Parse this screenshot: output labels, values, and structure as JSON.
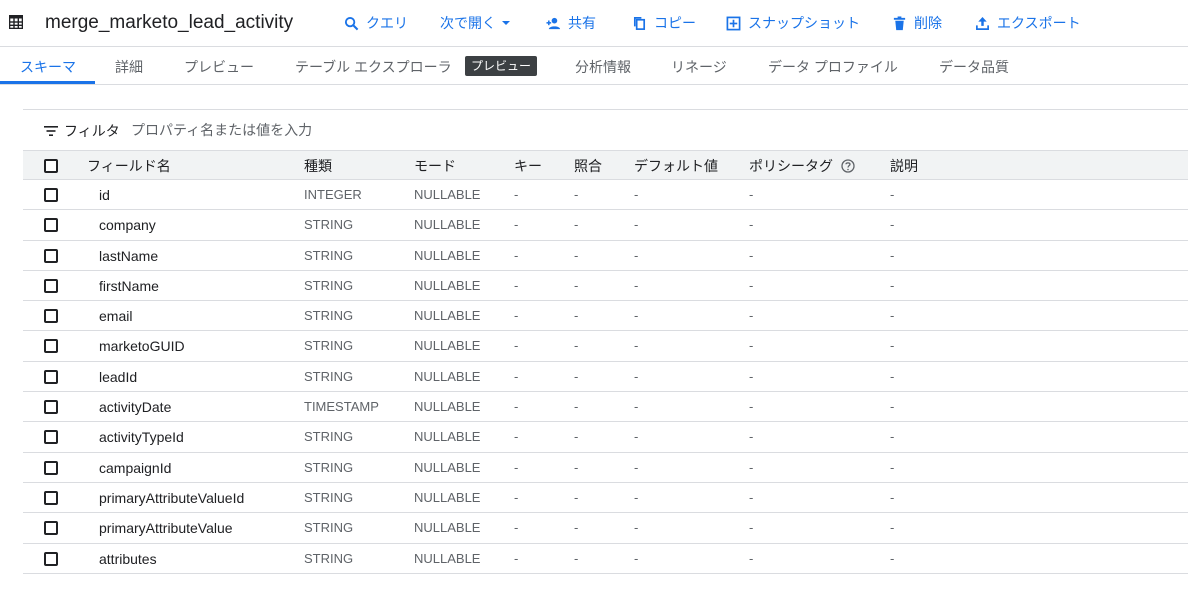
{
  "header": {
    "title": "merge_marketo_lead_activity",
    "actions": {
      "query": "クエリ",
      "open_with": "次で開く",
      "share": "共有",
      "copy": "コピー",
      "snapshot": "スナップショット",
      "delete": "削除",
      "export": "エクスポート"
    }
  },
  "tabs": {
    "schema": "スキーマ",
    "details": "詳細",
    "preview": "プレビュー",
    "table_explorer": "テーブル エクスプローラ",
    "table_explorer_badge": "プレビュー",
    "insights": "分析情報",
    "lineage": "リネージ",
    "data_profile": "データ プロファイル",
    "data_quality": "データ品質",
    "active": "schema"
  },
  "filter": {
    "label": "フィルタ",
    "placeholder": "プロパティ名または値を入力",
    "value": ""
  },
  "schema": {
    "columns": {
      "field_name": "フィールド名",
      "type": "種類",
      "mode": "モード",
      "key": "キー",
      "collation": "照合",
      "default_value": "デフォルト値",
      "policy_tags": "ポリシータグ",
      "description": "説明"
    },
    "rows": [
      {
        "name": "id",
        "type": "INTEGER",
        "mode": "NULLABLE",
        "key": "-",
        "collation": "-",
        "default": "-",
        "policy": "-",
        "description": "-"
      },
      {
        "name": "company",
        "type": "STRING",
        "mode": "NULLABLE",
        "key": "-",
        "collation": "-",
        "default": "-",
        "policy": "-",
        "description": "-"
      },
      {
        "name": "lastName",
        "type": "STRING",
        "mode": "NULLABLE",
        "key": "-",
        "collation": "-",
        "default": "-",
        "policy": "-",
        "description": "-"
      },
      {
        "name": "firstName",
        "type": "STRING",
        "mode": "NULLABLE",
        "key": "-",
        "collation": "-",
        "default": "-",
        "policy": "-",
        "description": "-"
      },
      {
        "name": "email",
        "type": "STRING",
        "mode": "NULLABLE",
        "key": "-",
        "collation": "-",
        "default": "-",
        "policy": "-",
        "description": "-"
      },
      {
        "name": "marketoGUID",
        "type": "STRING",
        "mode": "NULLABLE",
        "key": "-",
        "collation": "-",
        "default": "-",
        "policy": "-",
        "description": "-"
      },
      {
        "name": "leadId",
        "type": "STRING",
        "mode": "NULLABLE",
        "key": "-",
        "collation": "-",
        "default": "-",
        "policy": "-",
        "description": "-"
      },
      {
        "name": "activityDate",
        "type": "TIMESTAMP",
        "mode": "NULLABLE",
        "key": "-",
        "collation": "-",
        "default": "-",
        "policy": "-",
        "description": "-"
      },
      {
        "name": "activityTypeId",
        "type": "STRING",
        "mode": "NULLABLE",
        "key": "-",
        "collation": "-",
        "default": "-",
        "policy": "-",
        "description": "-"
      },
      {
        "name": "campaignId",
        "type": "STRING",
        "mode": "NULLABLE",
        "key": "-",
        "collation": "-",
        "default": "-",
        "policy": "-",
        "description": "-"
      },
      {
        "name": "primaryAttributeValueId",
        "type": "STRING",
        "mode": "NULLABLE",
        "key": "-",
        "collation": "-",
        "default": "-",
        "policy": "-",
        "description": "-"
      },
      {
        "name": "primaryAttributeValue",
        "type": "STRING",
        "mode": "NULLABLE",
        "key": "-",
        "collation": "-",
        "default": "-",
        "policy": "-",
        "description": "-"
      },
      {
        "name": "attributes",
        "type": "STRING",
        "mode": "NULLABLE",
        "key": "-",
        "collation": "-",
        "default": "-",
        "policy": "-",
        "description": "-"
      }
    ]
  },
  "colors": {
    "accent": "#1a73e8",
    "text": "#202124",
    "muted": "#5f6368",
    "divider": "#dadce0",
    "header_bg": "#f1f3f4",
    "badge_bg": "#3c4043"
  }
}
